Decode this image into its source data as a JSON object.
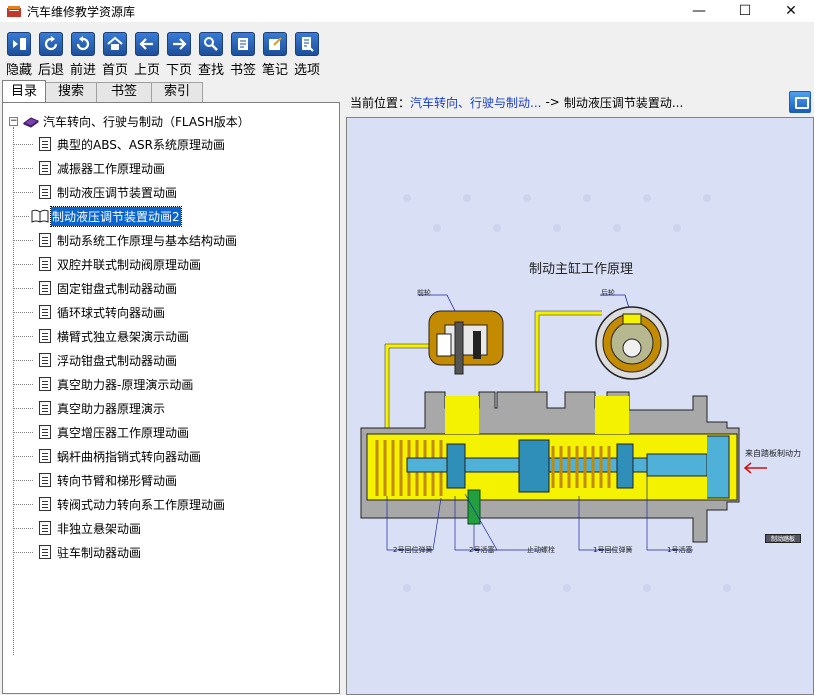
{
  "window": {
    "title": "汽车维修教学资源库",
    "controls": [
      "—",
      "☐",
      "✕"
    ]
  },
  "toolbar": {
    "buttons": [
      {
        "label": "隐藏",
        "icon": "hide-icon"
      },
      {
        "label": "后退",
        "icon": "back-icon"
      },
      {
        "label": "前进",
        "icon": "forward-icon"
      },
      {
        "label": "首页",
        "icon": "home-icon"
      },
      {
        "label": "上页",
        "icon": "prev-page-icon"
      },
      {
        "label": "下页",
        "icon": "next-page-icon"
      },
      {
        "label": "查找",
        "icon": "search-icon"
      },
      {
        "label": "书签",
        "icon": "bookmark-icon"
      },
      {
        "label": "笔记",
        "icon": "note-icon"
      },
      {
        "label": "选项",
        "icon": "options-icon"
      }
    ]
  },
  "tabs": [
    "目录",
    "搜索",
    "书签",
    "索引"
  ],
  "tree": {
    "root": "汽车转向、行驶与制动（FLASH版本）",
    "items": [
      "典型的ABS、ASR系统原理动画",
      "减振器工作原理动画",
      "制动液压调节装置动画",
      "制动液压调节装置动画2",
      "制动系统工作原理与基本结构动画",
      "双腔并联式制动阀原理动画",
      "固定钳盘式制动器动画",
      "循环球式转向器动画",
      "横臂式独立悬架演示动画",
      "浮动钳盘式制动器动画",
      "真空助力器-原理演示动画",
      "真空助力器原理演示",
      "真空增压器工作原理动画",
      "蜗杆曲柄指销式转向器动画",
      "转向节臂和梯形臂动画",
      "转阀式动力转向系工作原理动画",
      "非独立悬架动画",
      "驻车制动器动画"
    ],
    "selected_index": 3
  },
  "location": {
    "label": "当前位置：",
    "path": "汽车转向、行驶与制动...",
    "arrow": "->",
    "current": "制动液压调节装置动..."
  },
  "diagram": {
    "title": "制动主缸工作原理",
    "label_left_caliper": "前轮",
    "label_right_drum": "后轮",
    "label_pedal": "来自踏板制动力",
    "callouts": [
      "2号回位弹簧",
      "2号活塞",
      "止动螺栓",
      "1号回位弹簧",
      "1号活塞"
    ],
    "mini_button": "制动踏板",
    "colors": {
      "yellow": "#f5f200",
      "background": "#d9dff5",
      "piston": "#2f8fb8"
    }
  }
}
